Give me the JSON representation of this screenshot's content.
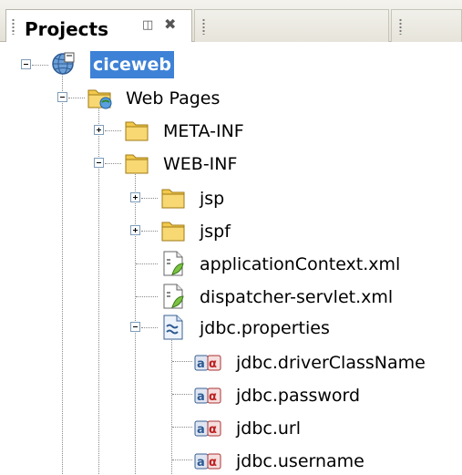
{
  "panel": {
    "title": "Projects",
    "minimize_glyph": "◫",
    "close_glyph": "✖"
  },
  "tree": {
    "project": "ciceweb",
    "web_pages": "Web Pages",
    "meta_inf": "META-INF",
    "web_inf": "WEB-INF",
    "jsp": "jsp",
    "jspf": "jspf",
    "application_context": "applicationContext.xml",
    "dispatcher_servlet": "dispatcher-servlet.xml",
    "jdbc_properties": "jdbc.properties",
    "properties": [
      "jdbc.driverClassName",
      "jdbc.password",
      "jdbc.url",
      "jdbc.username"
    ]
  },
  "colors": {
    "selection": "#3d82d6",
    "folder": "#f2c94c"
  }
}
